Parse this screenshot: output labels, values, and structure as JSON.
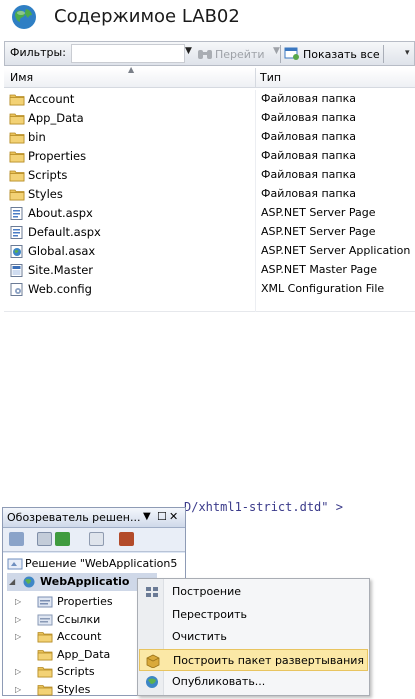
{
  "top_panel": {
    "title": "Содержимое LAB02",
    "toolbar": {
      "filter_label": "Фильтры:",
      "go_label": "Перейти",
      "show_all_label": "Показать все"
    },
    "columns": {
      "name": "Имя",
      "type": "Тип"
    },
    "items": [
      {
        "name": "Account",
        "type": "Файловая папка",
        "icon": "folder-icon"
      },
      {
        "name": "App_Data",
        "type": "Файловая папка",
        "icon": "folder-icon"
      },
      {
        "name": "bin",
        "type": "Файловая папка",
        "icon": "folder-icon"
      },
      {
        "name": "Properties",
        "type": "Файловая папка",
        "icon": "folder-icon"
      },
      {
        "name": "Scripts",
        "type": "Файловая папка",
        "icon": "folder-icon"
      },
      {
        "name": "Styles",
        "type": "Файловая папка",
        "icon": "folder-icon"
      },
      {
        "name": "About.aspx",
        "type": "ASP.NET Server Page",
        "icon": "aspx-page-icon"
      },
      {
        "name": "Default.aspx",
        "type": "ASP.NET Server Page",
        "icon": "aspx-page-icon"
      },
      {
        "name": "Global.asax",
        "type": "ASP.NET Server Application",
        "icon": "asax-app-icon"
      },
      {
        "name": "Site.Master",
        "type": "ASP.NET Master Page",
        "icon": "master-page-icon"
      },
      {
        "name": "Web.config",
        "type": "XML Configuration File",
        "icon": "config-file-icon"
      }
    ]
  },
  "bottom_panel": {
    "code_fragment": "D/xhtml1-strict.dtd\" >",
    "solution_explorer": {
      "title": "Обозреватель решен...",
      "tree": {
        "solution": "Решение \"WebApplication5",
        "project": "WebApplicatio",
        "children": [
          "Properties",
          "Ссылки",
          "Account",
          "App_Data",
          "Scripts",
          "Styles"
        ]
      }
    },
    "context_menu": {
      "items": [
        {
          "label": "Построение",
          "icon": "build-icon",
          "highlighted": false
        },
        {
          "label": "Перестроить",
          "icon": "",
          "highlighted": false
        },
        {
          "label": "Очистить",
          "icon": "",
          "highlighted": false
        },
        {
          "label": "Построить пакет развертывания",
          "icon": "package-icon",
          "highlighted": true
        },
        {
          "label": "Опубликовать...",
          "icon": "publish-icon",
          "highlighted": false
        }
      ]
    }
  },
  "colors": {
    "folder": "#e9c25a",
    "highlight": "#fbe8a6",
    "panel_blue": "#dde6f4"
  }
}
